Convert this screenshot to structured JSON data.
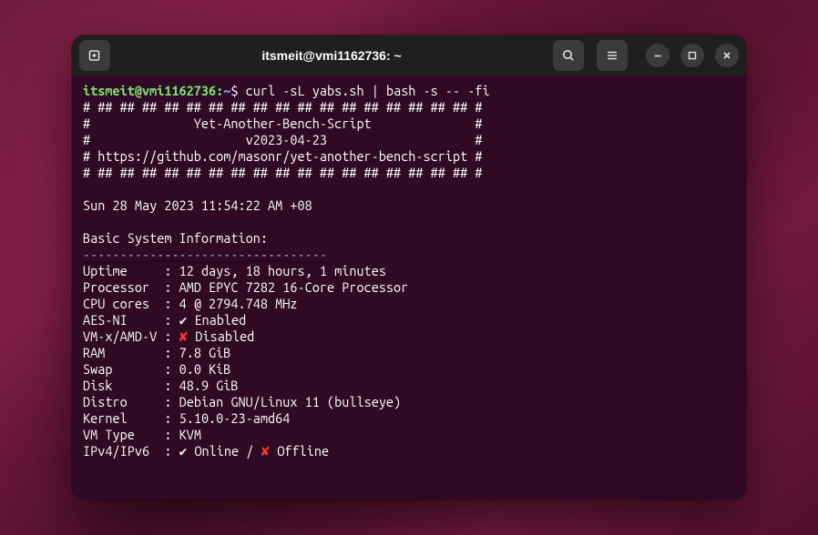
{
  "titlebar": {
    "title": "itsmeit@vmi1162736: ~"
  },
  "prompt": {
    "user_host": "itsmeit@vmi1162736",
    "path": "~",
    "dollar": "$",
    "command": "curl -sL yabs.sh | bash -s -- -fi"
  },
  "header": {
    "line1": "# ## ## ## ## ## ## ## ## ## ## ## ## ## ## ## ## ## #",
    "line2": "#              Yet-Another-Bench-Script              #",
    "line3": "#                     v2023-04-23                    #",
    "line4": "# https://github.com/masonr/yet-another-bench-script #",
    "line5": "# ## ## ## ## ## ## ## ## ## ## ## ## ## ## ## ## ## #"
  },
  "timestamp": "Sun 28 May 2023 11:54:22 AM +08",
  "section_title": "Basic System Information:",
  "divider": "---------------------------------",
  "info": {
    "uptime": {
      "label": "Uptime    ",
      "value": "12 days, 18 hours, 1 minutes"
    },
    "processor": {
      "label": "Processor ",
      "value": "AMD EPYC 7282 16-Core Processor"
    },
    "cpucores": {
      "label": "CPU cores ",
      "value": "4 @ 2794.748 MHz"
    },
    "aesni": {
      "label": "AES-NI    ",
      "value": "Enabled",
      "mark": "check"
    },
    "vmxamd": {
      "label": "VM-x/AMD-V",
      "value": "Disabled",
      "mark": "cross"
    },
    "ram": {
      "label": "RAM       ",
      "value": "7.8 GiB"
    },
    "swap": {
      "label": "Swap      ",
      "value": "0.0 KiB"
    },
    "disk": {
      "label": "Disk      ",
      "value": "48.9 GiB"
    },
    "distro": {
      "label": "Distro    ",
      "value": "Debian GNU/Linux 11 (bullseye)"
    },
    "kernel": {
      "label": "Kernel    ",
      "value": "5.10.0-23-amd64"
    },
    "vmtype": {
      "label": "VM Type   ",
      "value": "KVM"
    },
    "ipv": {
      "label": "IPv4/IPv6 ",
      "online": "Online",
      "offline": "Offline"
    }
  },
  "checkmark": "✔",
  "crossmark": "✘"
}
